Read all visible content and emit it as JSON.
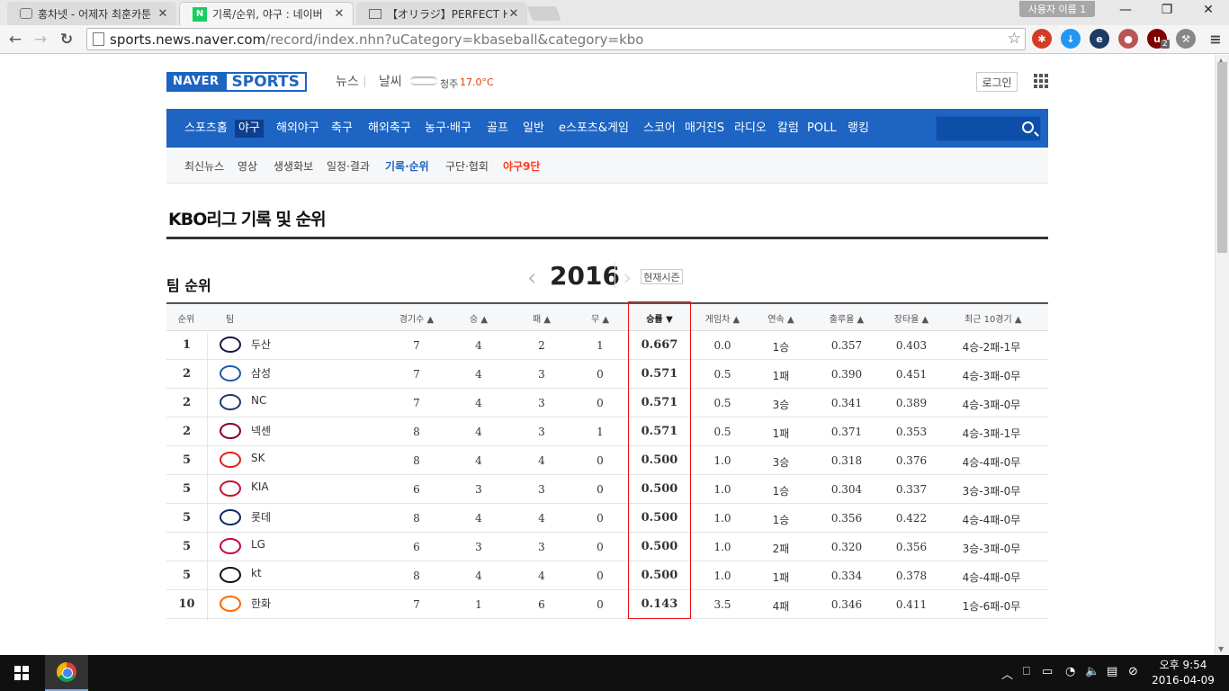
{
  "browser": {
    "tabs": [
      {
        "title": "홍차넷 - 어제자 최훈카툰",
        "close": "✕",
        "state": "inactive"
      },
      {
        "title": "기록/순위, 야구 : 네이버",
        "close": "✕",
        "state": "active"
      },
      {
        "title": "【オリラジ】PERFECT H",
        "close": "✕",
        "state": "inactive"
      }
    ],
    "user_label": "사용자 이름 1",
    "window_controls": {
      "minimize": "—",
      "restore": "❐",
      "close": "✕"
    },
    "nav": {
      "back": "←",
      "forward": "→",
      "reload": "↻"
    },
    "url_host": "sports.news.naver.com",
    "url_rest": "/record/index.nhn?uCategory=kbaseball&category=kbo",
    "star": "☆",
    "extensions": [
      {
        "icon": "lastpass-icon",
        "glyph": "✱",
        "color": "#d43c26"
      },
      {
        "icon": "download-icon",
        "glyph": "↓",
        "color": "#2196f3"
      },
      {
        "icon": "ie-tab-icon",
        "glyph": "e",
        "color": "#1f3a63"
      },
      {
        "icon": "mouse-gesture-icon",
        "glyph": "●",
        "color": "#b55"
      },
      {
        "icon": "ublock-icon",
        "glyph": "u",
        "color": "#800000"
      },
      {
        "icon": "tools-icon",
        "glyph": "⚒",
        "color": "#888"
      },
      {
        "icon": "menu-icon",
        "glyph": "≡",
        "color": "#f5f5f5"
      }
    ],
    "ublock_badge": "2"
  },
  "header": {
    "logo_naver": "NAVER",
    "logo_sports": "SPORTS",
    "news": "뉴스",
    "weather": "날씨",
    "city": "청주",
    "temp": "17.0°C",
    "login": "로그인"
  },
  "gnb": [
    "스포츠홈",
    "야구",
    "해외야구",
    "축구",
    "해외축구",
    "농구·배구",
    "골프",
    "일반",
    "e스포츠&게임",
    "스코어",
    "매거진S",
    "라디오",
    "칼럼",
    "POLL",
    "랭킹"
  ],
  "lnb": [
    "최신뉴스",
    "영상",
    "생생화보",
    "일정·결과",
    "기록·순위",
    "구단·협회",
    "야구9단"
  ],
  "page_title": "KBO리그 기록 및 순위",
  "ranking": {
    "title": "팀 순위",
    "year": "2016",
    "prev": "‹",
    "next": "›",
    "current_season": "현재시즌",
    "columns": [
      "순위",
      "팀",
      "경기수 ▲",
      "승 ▲",
      "패 ▲",
      "무 ▲",
      "승률 ▼",
      "게임차 ▲",
      "연속 ▲",
      "출루율 ▲",
      "장타율 ▲",
      "최근 10경기 ▲"
    ],
    "rows": [
      {
        "rank": "1",
        "team": "두산",
        "g": "7",
        "w": "4",
        "l": "2",
        "d": "1",
        "pct": "0.667",
        "gb": "0.0",
        "streak": "1승",
        "obp": "0.357",
        "slg": "0.403",
        "last10": "4승-2패-1무",
        "color": "#1a1748"
      },
      {
        "rank": "2",
        "team": "삼성",
        "g": "7",
        "w": "4",
        "l": "3",
        "d": "0",
        "pct": "0.571",
        "gb": "0.5",
        "streak": "1패",
        "obp": "0.390",
        "slg": "0.451",
        "last10": "4승-3패-0무",
        "color": "#1f5ba8"
      },
      {
        "rank": "2",
        "team": "NC",
        "g": "7",
        "w": "4",
        "l": "3",
        "d": "0",
        "pct": "0.571",
        "gb": "0.5",
        "streak": "3승",
        "obp": "0.341",
        "slg": "0.389",
        "last10": "4승-3패-0무",
        "color": "#1b3b6f"
      },
      {
        "rank": "2",
        "team": "넥센",
        "g": "8",
        "w": "4",
        "l": "3",
        "d": "1",
        "pct": "0.571",
        "gb": "0.5",
        "streak": "1패",
        "obp": "0.371",
        "slg": "0.353",
        "last10": "4승-3패-1무",
        "color": "#820024"
      },
      {
        "rank": "5",
        "team": "SK",
        "g": "8",
        "w": "4",
        "l": "4",
        "d": "0",
        "pct": "0.500",
        "gb": "1.0",
        "streak": "3승",
        "obp": "0.318",
        "slg": "0.376",
        "last10": "4승-4패-0무",
        "color": "#e0201f"
      },
      {
        "rank": "5",
        "team": "KIA",
        "g": "6",
        "w": "3",
        "l": "3",
        "d": "0",
        "pct": "0.500",
        "gb": "1.0",
        "streak": "1승",
        "obp": "0.304",
        "slg": "0.337",
        "last10": "3승-3패-0무",
        "color": "#c8102e"
      },
      {
        "rank": "5",
        "team": "롯데",
        "g": "8",
        "w": "4",
        "l": "4",
        "d": "0",
        "pct": "0.500",
        "gb": "1.0",
        "streak": "1승",
        "obp": "0.356",
        "slg": "0.422",
        "last10": "4승-4패-0무",
        "color": "#0a2a62"
      },
      {
        "rank": "5",
        "team": "LG",
        "g": "6",
        "w": "3",
        "l": "3",
        "d": "0",
        "pct": "0.500",
        "gb": "1.0",
        "streak": "2패",
        "obp": "0.320",
        "slg": "0.356",
        "last10": "3승-3패-0무",
        "color": "#c30452"
      },
      {
        "rank": "5",
        "team": "kt",
        "g": "8",
        "w": "4",
        "l": "4",
        "d": "0",
        "pct": "0.500",
        "gb": "1.0",
        "streak": "1패",
        "obp": "0.334",
        "slg": "0.378",
        "last10": "4승-4패-0무",
        "color": "#111111"
      },
      {
        "rank": "10",
        "team": "한화",
        "g": "7",
        "w": "1",
        "l": "6",
        "d": "0",
        "pct": "0.143",
        "gb": "3.5",
        "streak": "4패",
        "obp": "0.346",
        "slg": "0.411",
        "last10": "1승-6패-0무",
        "color": "#ff6600"
      }
    ]
  },
  "taskbar": {
    "tray": [
      "︿",
      "⎕",
      "▭",
      "◔",
      "🔈",
      "▤",
      "⊘"
    ],
    "time": "오후 9:54",
    "date": "2016-04-09"
  },
  "colors": {
    "brand": "#1d64c3",
    "brand_dark": "#0d3f8e",
    "highlight": "#e11111"
  }
}
